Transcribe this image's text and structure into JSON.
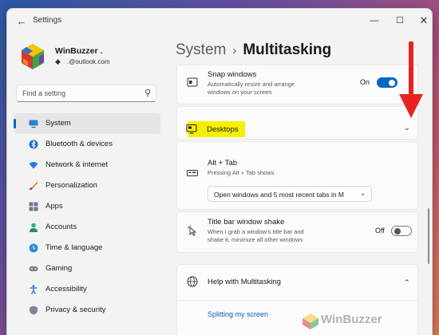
{
  "window": {
    "title": "Settings",
    "back_glyph": "←",
    "minimize_glyph": "—",
    "maximize_glyph": "☐",
    "close_glyph": "✕"
  },
  "user": {
    "name": "WinBuzzer .",
    "email": ".@outlook.com"
  },
  "search": {
    "placeholder": "Find a setting",
    "icon": "search-icon"
  },
  "sidebar": {
    "items": [
      {
        "label": "System",
        "icon": "monitor-icon",
        "active": true
      },
      {
        "label": "Bluetooth & devices",
        "icon": "bluetooth-icon"
      },
      {
        "label": "Network & internet",
        "icon": "wifi-icon"
      },
      {
        "label": "Personalization",
        "icon": "brush-icon"
      },
      {
        "label": "Apps",
        "icon": "apps-icon"
      },
      {
        "label": "Accounts",
        "icon": "person-icon"
      },
      {
        "label": "Time & language",
        "icon": "globe-clock-icon"
      },
      {
        "label": "Gaming",
        "icon": "gamepad-icon"
      },
      {
        "label": "Accessibility",
        "icon": "accessibility-icon"
      },
      {
        "label": "Privacy & security",
        "icon": "shield-icon"
      }
    ]
  },
  "breadcrumb": {
    "parent": "System",
    "separator": "›",
    "current": "Multitasking"
  },
  "settings": {
    "snap": {
      "title": "Snap windows",
      "desc_line1": "Automatically resize and arrange",
      "desc_line2": "windows on your screen",
      "state_label": "On",
      "state": true
    },
    "desktops": {
      "title": "Desktops",
      "chevron": "⌄"
    },
    "alt_tab": {
      "title": "Alt + Tab",
      "desc": "Pressing Alt + Tab shows",
      "selected": "Open windows and 5 most recent tabs in M",
      "chevron": "⌄"
    },
    "shake": {
      "title": "Title bar window shake",
      "desc_line1": "When I grab a window's title bar and",
      "desc_line2": "shake it, minimize all other windows",
      "state_label": "Off",
      "state": false
    },
    "help": {
      "title": "Help with Multitasking",
      "chevron": "⌃",
      "link": "Splitting my screen"
    }
  },
  "watermark": "WinBuzzer",
  "colors": {
    "accent": "#0067c0",
    "highlight": "#f4f000",
    "annotation_arrow": "#e8231f"
  }
}
